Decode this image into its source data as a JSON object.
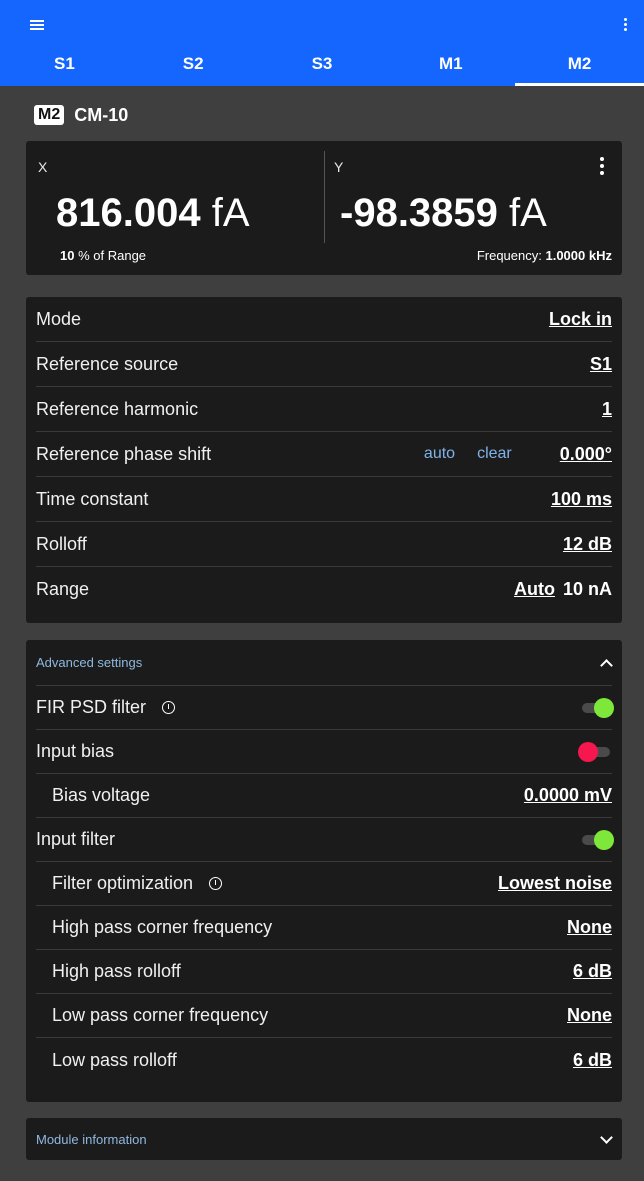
{
  "appbar": {
    "tabs": [
      {
        "label": "S1"
      },
      {
        "label": "S2"
      },
      {
        "label": "S3"
      },
      {
        "label": "M1"
      },
      {
        "label": "M2",
        "active": true
      }
    ],
    "color": "#1565ff"
  },
  "module": {
    "badge": "M2",
    "name": "CM-10"
  },
  "measurement": {
    "x_label": "X",
    "x_value": "816.004",
    "x_unit": "fA",
    "y_label": "Y",
    "y_value": "-98.3859",
    "y_unit": "fA",
    "range_percent": "10",
    "range_suffix": "% of Range",
    "frequency_label": "Frequency:",
    "frequency_value": "1.0000",
    "frequency_unit": "kHz"
  },
  "settings": {
    "mode": {
      "label": "Mode",
      "value": "Lock in"
    },
    "reference_source": {
      "label": "Reference source",
      "value": "S1"
    },
    "reference_harmonic": {
      "label": "Reference harmonic",
      "value": "1"
    },
    "reference_phase_shift": {
      "label": "Reference phase shift",
      "auto": "auto",
      "clear": "clear",
      "value": "0.000°"
    },
    "time_constant": {
      "label": "Time constant",
      "value": "100 ms"
    },
    "rolloff": {
      "label": "Rolloff",
      "value": "12 dB"
    },
    "range": {
      "label": "Range",
      "auto": "Auto",
      "value": "10 nA"
    }
  },
  "advanced": {
    "title": "Advanced settings",
    "fir_psd_filter": {
      "label": "FIR PSD filter",
      "state": "on"
    },
    "input_bias": {
      "label": "Input bias",
      "state": "off"
    },
    "bias_voltage": {
      "label": "Bias voltage",
      "value": "0.0000 mV"
    },
    "input_filter": {
      "label": "Input filter",
      "state": "on"
    },
    "filter_optimization": {
      "label": "Filter optimization",
      "value": "Lowest noise"
    },
    "high_pass_corner": {
      "label": "High pass corner frequency",
      "value": "None"
    },
    "high_pass_rolloff": {
      "label": "High pass rolloff",
      "value": "6 dB"
    },
    "low_pass_corner": {
      "label": "Low pass corner frequency",
      "value": "None"
    },
    "low_pass_rolloff": {
      "label": "Low pass rolloff",
      "value": "6 dB"
    }
  },
  "module_information": {
    "title": "Module information"
  },
  "colors": {
    "toggle_on": "#7ee83a",
    "toggle_off": "#f5174e",
    "accent_text": "#8fb8e0"
  }
}
